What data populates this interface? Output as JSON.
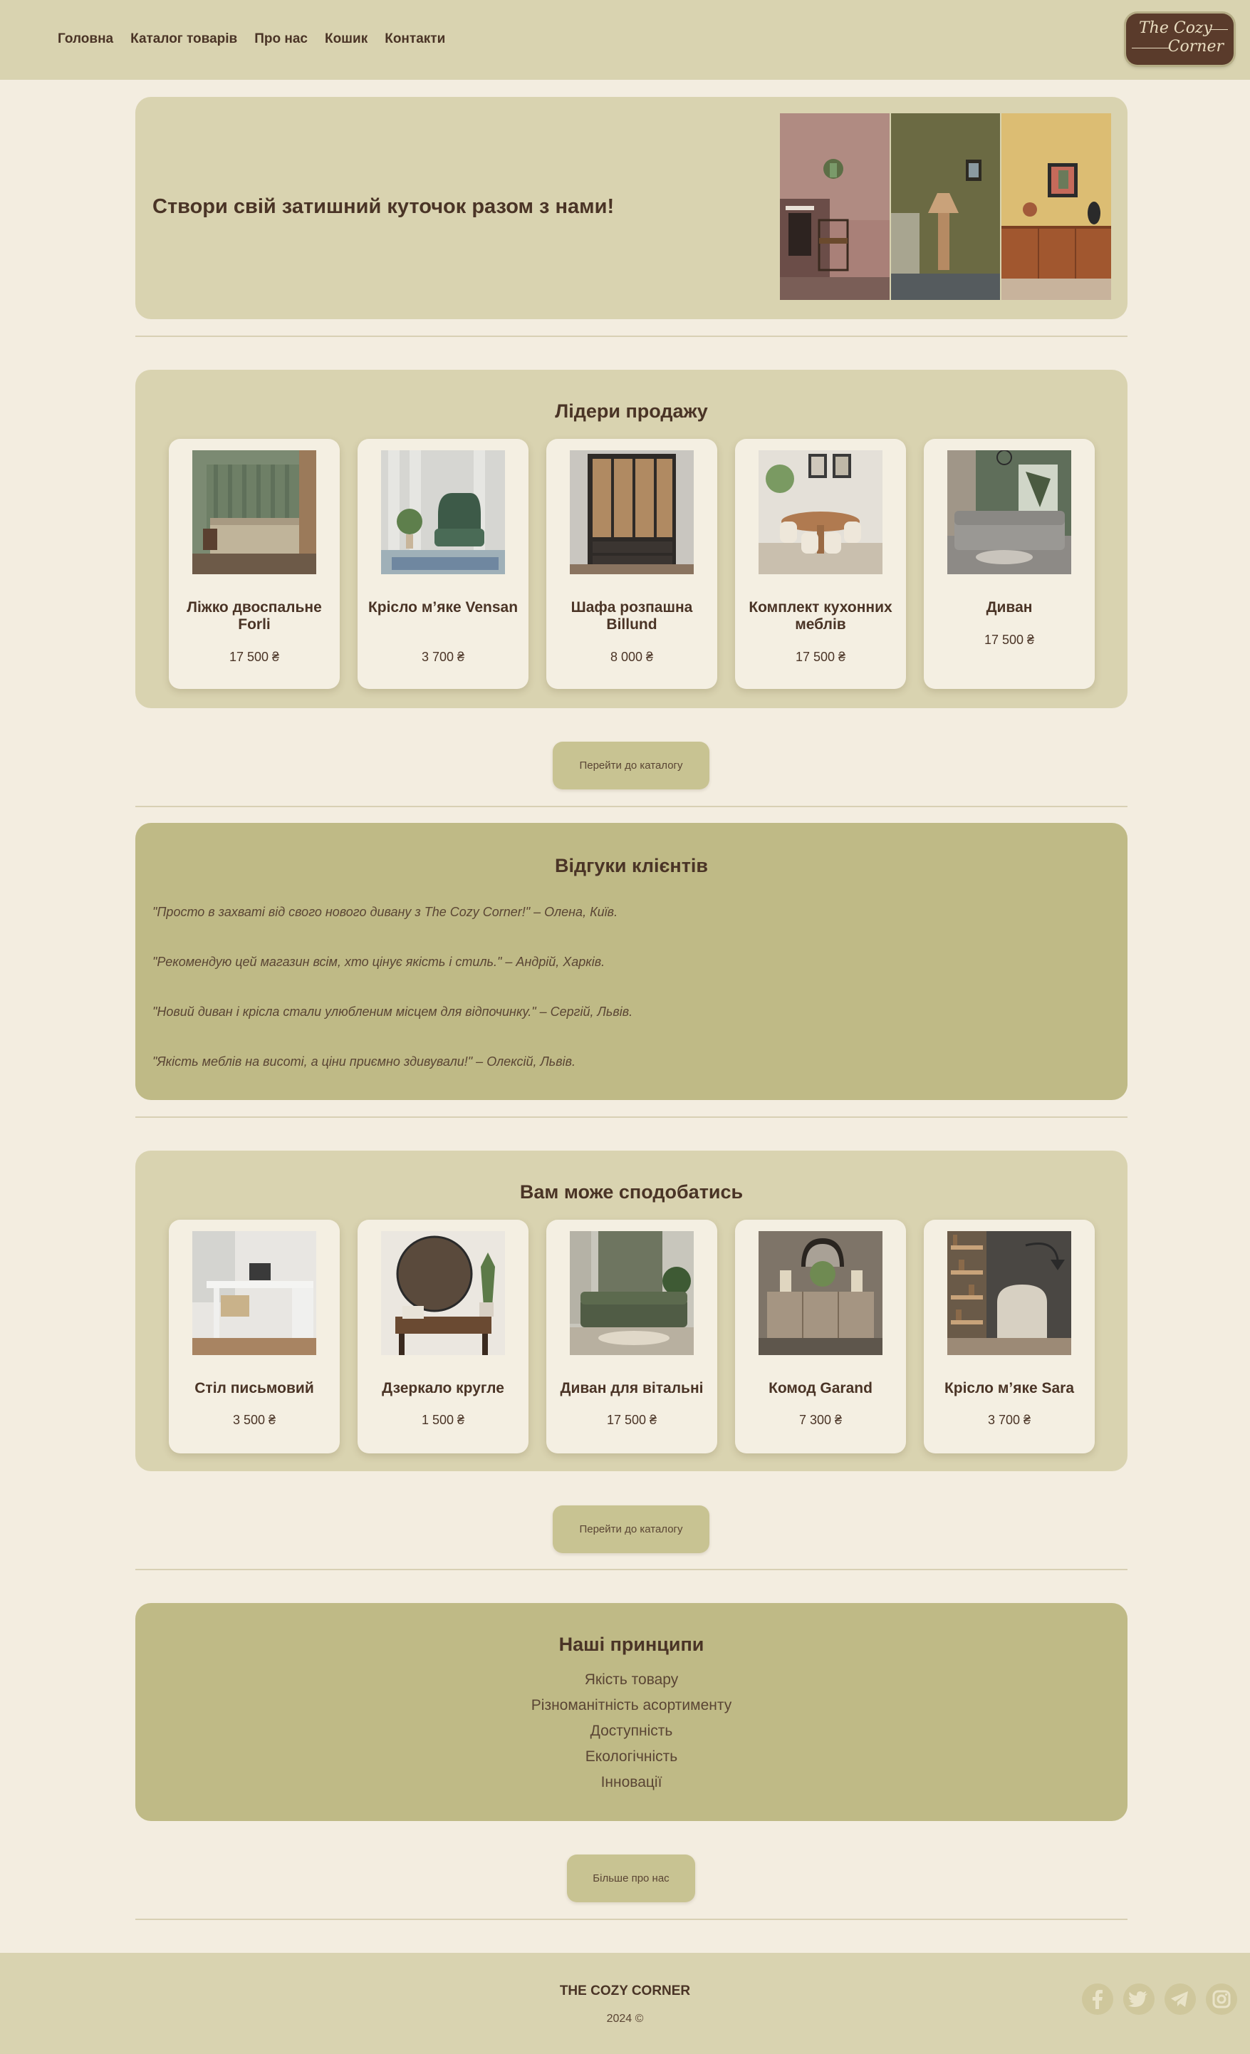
{
  "nav": {
    "items": [
      "Головна",
      "Каталог товарів",
      "Про нас",
      "Кошик",
      "Контакти"
    ]
  },
  "logo": {
    "line1": "The Cozy",
    "line2": "Corner"
  },
  "hero": {
    "title": "Створи свій затишний куточок разом з нами!"
  },
  "bestsellers": {
    "title": "Лідери продажу",
    "products": [
      {
        "name": "Ліжко двоспальне Forli",
        "price": "17 500 ₴"
      },
      {
        "name": "Крісло м’яке Vensan",
        "price": "3 700 ₴"
      },
      {
        "name": "Шафа розпашна Billund",
        "price": "8 000 ₴"
      },
      {
        "name": "Комплект кухонних меблів",
        "price": "17 500 ₴"
      },
      {
        "name": "Диван",
        "price": "17 500 ₴"
      }
    ],
    "button": "Перейти до каталогу"
  },
  "reviews": {
    "title": "Відгуки клієнтів",
    "items": [
      "\"Просто в захваті від свого нового дивану з The Cozy Corner!\" – Олена, Київ.",
      "\"Рекомендую цей магазин всім, хто цінує якість і стиль.\" – Андрій, Харків.",
      "\"Новий диван і крісла стали улюбленим місцем для відпочинку.\" – Сергій, Львів.",
      "\"Якість меблів на висоті, а ціни приємно здивували!\" – Олексій, Львів."
    ]
  },
  "recommended": {
    "title": "Вам може сподобатись",
    "products": [
      {
        "name": "Стіл письмовий",
        "price": "3 500 ₴"
      },
      {
        "name": "Дзеркало кругле",
        "price": "1 500 ₴"
      },
      {
        "name": "Диван для вітальні",
        "price": "17 500 ₴"
      },
      {
        "name": "Комод Garand",
        "price": "7 300 ₴"
      },
      {
        "name": "Крісло м’яке Sara",
        "price": "3 700 ₴"
      }
    ],
    "button": "Перейти до каталогу"
  },
  "principles": {
    "title": "Наші принципи",
    "items": [
      "Якість товару",
      "Різноманітність асортименту",
      "Доступність",
      "Екологічність",
      "Інновації"
    ],
    "button": "Більше про нас"
  },
  "footer": {
    "brand": "THE COZY CORNER",
    "year": "2024 ©",
    "social_icons": [
      "facebook-icon",
      "twitter-icon",
      "telegram-icon",
      "instagram-icon"
    ]
  },
  "colors": {
    "page_bg": "#f3ede0",
    "header_bg": "#d9d3b0",
    "panel_olive": "#bfba86",
    "text_brown": "#4a3426",
    "logo_bg": "#5a3b2b"
  }
}
